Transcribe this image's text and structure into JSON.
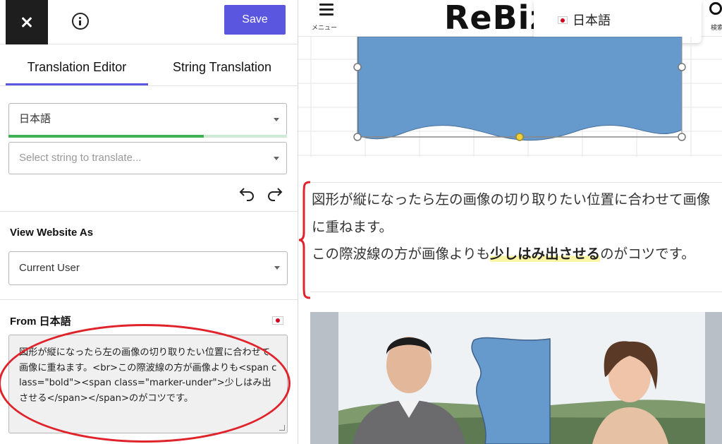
{
  "editor": {
    "save_label": "Save",
    "tabs": [
      {
        "label": "Translation Editor",
        "active": true
      },
      {
        "label": "String Translation",
        "active": false
      }
    ],
    "language_select": {
      "value": "日本語",
      "progress_fraction": 0.7
    },
    "string_select": {
      "placeholder": "Select string to translate..."
    },
    "view_as": {
      "title": "View Website As",
      "value": "Current User"
    },
    "from": {
      "title": "From 日本語",
      "source_text": "図形が縦になったら左の画像の切り取りたい位置に合わせて画像に重ねます。<br>この際波線の方が画像よりも<span class=\"bold\"><span class=\"marker-under\">少しはみ出させる</span></span>のがコツです。"
    }
  },
  "preview": {
    "header": {
      "menu_label": "メニュー",
      "logo_text": "ReBiz",
      "search_label": "検索"
    },
    "language_dropdown": {
      "option": "日本語"
    },
    "paragraph": {
      "line1": "図形が縦になったら左の画像の切り取りたい位置に合わせて画像に重ねます。",
      "line2_before": "この際波線の方が画像よりも",
      "line2_bold": "少しはみ出させる",
      "line2_after": "のがコツです。"
    }
  },
  "colors": {
    "accent": "#5a56e0",
    "progress": "#3eb055",
    "annotation_red": "#e0232b",
    "shape_blue": "#6699cc",
    "marker_yellow": "#fbf6a6"
  }
}
